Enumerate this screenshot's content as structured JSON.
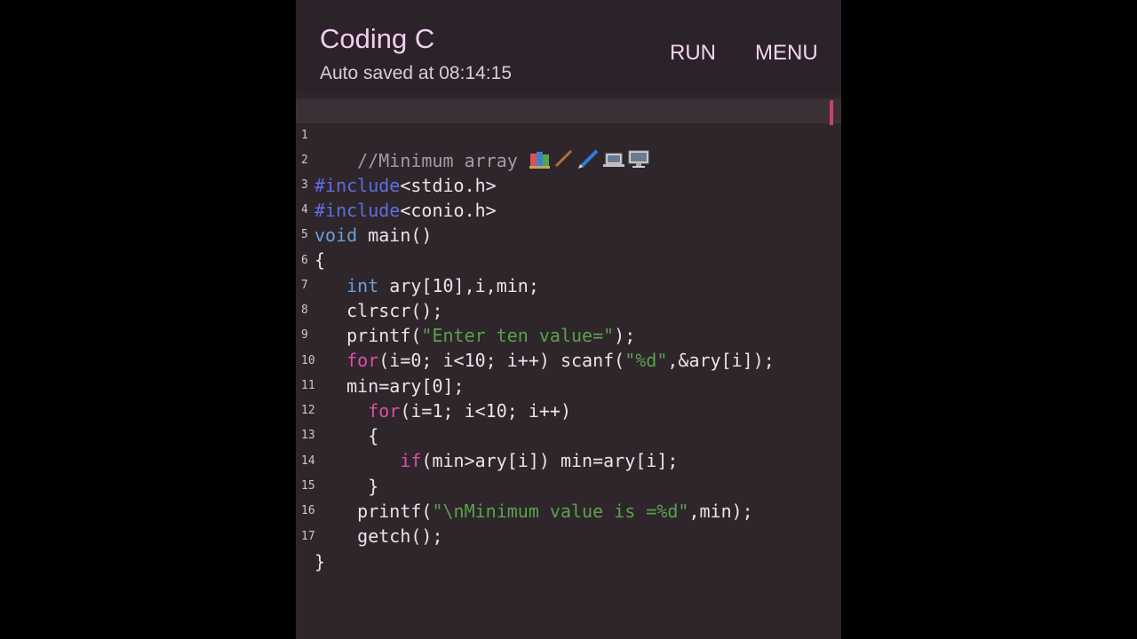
{
  "app": {
    "title": "Coding C",
    "subtitle": "Auto saved at 08:14:15",
    "run_label": "RUN",
    "menu_label": "MENU"
  },
  "editor": {
    "lines": [
      {
        "num": "1",
        "comment": "//Minimum array ",
        "emoji": [
          "books-icon",
          "pen-icon",
          "pencil-icon",
          "laptop-icon",
          "desktop-icon"
        ]
      },
      {
        "num": "2",
        "pp": "#include",
        "rest": "<stdio.h>"
      },
      {
        "num": "3",
        "pp": "#include",
        "rest": "<conio.h>"
      },
      {
        "num": "4",
        "kw": "void",
        "rest": " main()"
      },
      {
        "num": "5",
        "rest": "{"
      },
      {
        "num": "6",
        "indent": "   ",
        "kw": "int",
        "rest": " ary[10],i,min;"
      },
      {
        "num": "7",
        "indent": "   ",
        "rest": "clrscr();"
      },
      {
        "num": "8",
        "indent": "   ",
        "pre": "printf(",
        "str": "\"Enter ten value=\"",
        "post": ");"
      },
      {
        "num": "9",
        "indent": "   ",
        "kwp": "for",
        "pre": "(i=0; i<10; i++) scanf(",
        "str": "\"%d\"",
        "post": ",&ary[i]);"
      },
      {
        "num": "10",
        "indent": "   ",
        "rest": "min=ary[0];"
      },
      {
        "num": "11",
        "indent": "     ",
        "kwp": "for",
        "rest": "(i=1; i<10; i++)"
      },
      {
        "num": "12",
        "indent": "     ",
        "rest": "{"
      },
      {
        "num": "13",
        "indent": "        ",
        "kwp": "if",
        "rest": "(min>ary[i]) min=ary[i];"
      },
      {
        "num": "14",
        "indent": "     ",
        "rest": "}"
      },
      {
        "num": "15",
        "indent": "    ",
        "pre": "printf(",
        "str": "\"\\nMinimum value is =%d\"",
        "post": ",min);"
      },
      {
        "num": "16",
        "indent": "    ",
        "rest": "getch();"
      },
      {
        "num": "17",
        "rest": "}"
      }
    ]
  }
}
